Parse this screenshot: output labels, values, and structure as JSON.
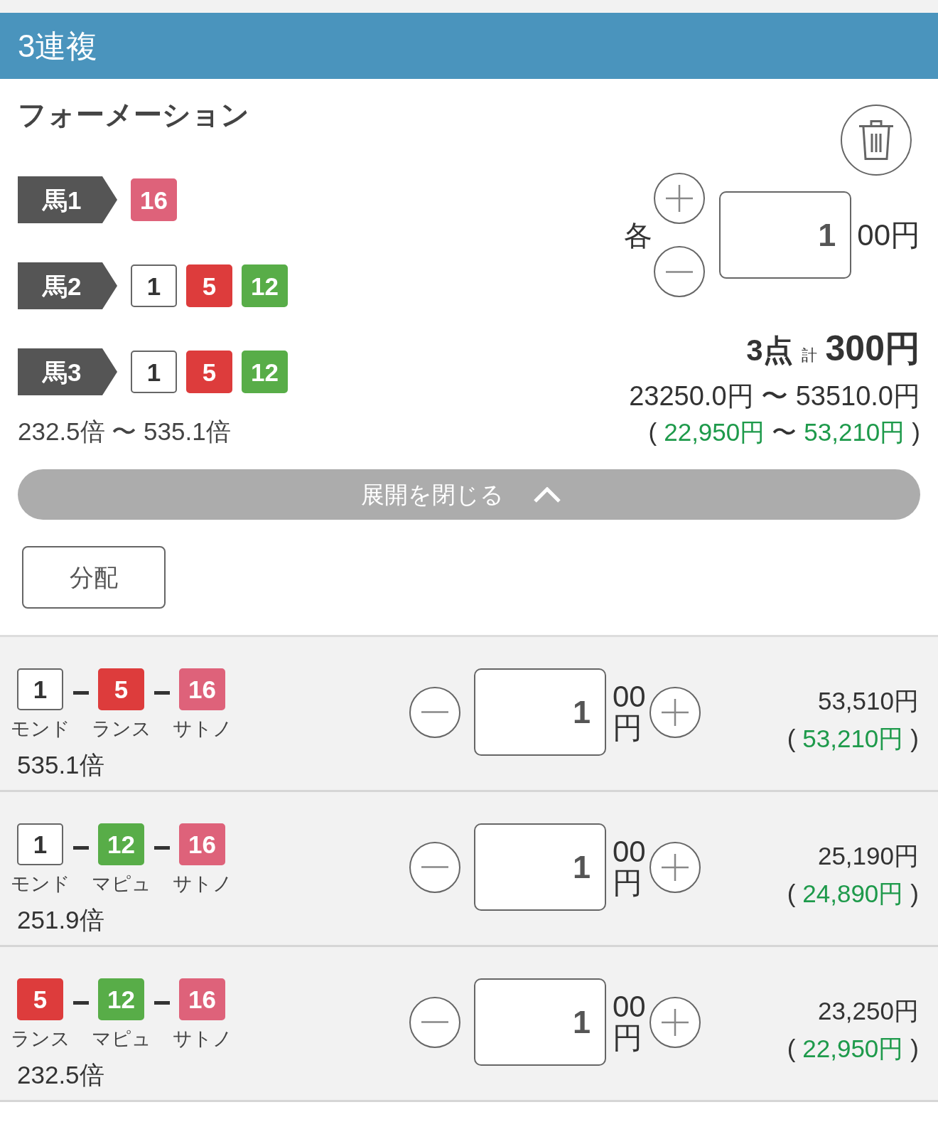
{
  "header": {
    "title": "3連複"
  },
  "formation": {
    "title": "フォーメーション",
    "positions": [
      {
        "label": "馬1",
        "horses": [
          {
            "number": "16",
            "color": "#de627a"
          }
        ]
      },
      {
        "label": "馬2",
        "horses": [
          {
            "number": "1",
            "color": "#ffffff"
          },
          {
            "number": "5",
            "color": "#dd3c3c"
          },
          {
            "number": "12",
            "color": "#58ad48"
          }
        ]
      },
      {
        "label": "馬3",
        "horses": [
          {
            "number": "1",
            "color": "#ffffff"
          },
          {
            "number": "5",
            "color": "#dd3c3c"
          },
          {
            "number": "12",
            "color": "#58ad48"
          }
        ]
      }
    ],
    "odds_range": "232.5倍 〜 535.1倍",
    "unit_label": "各",
    "amount": "1",
    "unit": "00円",
    "points": "3点",
    "total_label": "計",
    "total": "300円",
    "payout_range": "23250.0円 〜 53510.0円",
    "profit_range": {
      "open": "(",
      "low": "22,950円",
      "separator": "〜",
      "high": "53,210円",
      "close": ")"
    }
  },
  "collapse_button": {
    "label": "展開を閉じる"
  },
  "distribute_button": {
    "label": "分配"
  },
  "combinations": [
    {
      "horses": [
        {
          "number": "1",
          "name": "モンド",
          "color": "#ffffff"
        },
        {
          "number": "5",
          "name": "ランス",
          "color": "#dd3c3c"
        },
        {
          "number": "16",
          "name": "サトノ",
          "color": "#de627a"
        }
      ],
      "odds": "535.1倍",
      "amount": "1",
      "unit": "00円",
      "payout": "53,510円",
      "profit": {
        "open": "(",
        "value": "53,210円",
        "close": ")"
      }
    },
    {
      "horses": [
        {
          "number": "1",
          "name": "モンド",
          "color": "#ffffff"
        },
        {
          "number": "12",
          "name": "マピュ",
          "color": "#58ad48"
        },
        {
          "number": "16",
          "name": "サトノ",
          "color": "#de627a"
        }
      ],
      "odds": "251.9倍",
      "amount": "1",
      "unit": "00円",
      "payout": "25,190円",
      "profit": {
        "open": "(",
        "value": "24,890円",
        "close": ")"
      }
    },
    {
      "horses": [
        {
          "number": "5",
          "name": "ランス",
          "color": "#dd3c3c"
        },
        {
          "number": "12",
          "name": "マピュ",
          "color": "#58ad48"
        },
        {
          "number": "16",
          "name": "サトノ",
          "color": "#de627a"
        }
      ],
      "odds": "232.5倍",
      "amount": "1",
      "unit": "00円",
      "payout": "23,250円",
      "profit": {
        "open": "(",
        "value": "22,950円",
        "close": ")"
      }
    }
  ]
}
